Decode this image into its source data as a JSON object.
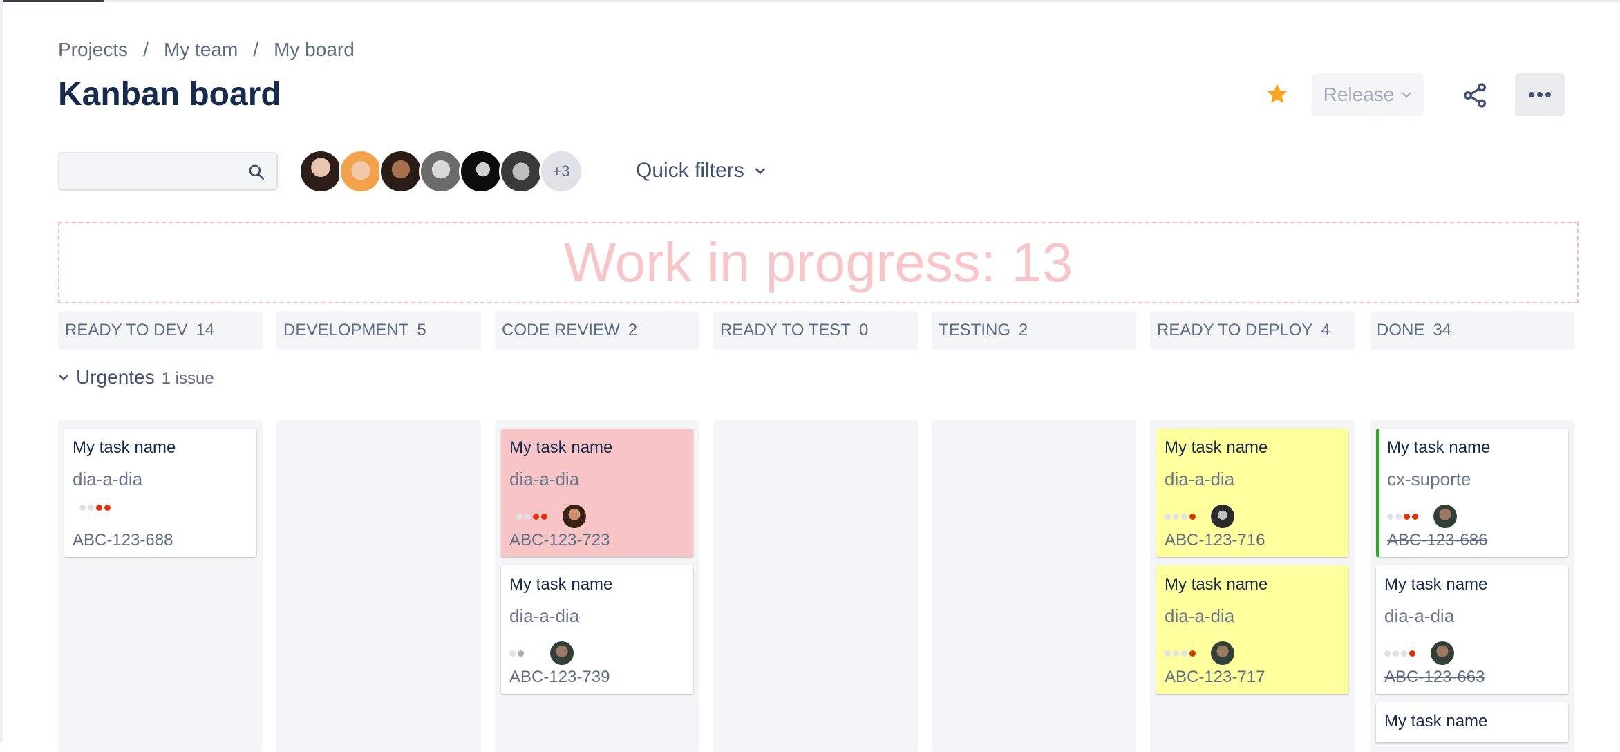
{
  "breadcrumbs": [
    "Projects",
    "My team",
    "My board"
  ],
  "title": "Kanban board",
  "header_actions": {
    "release_label": "Release"
  },
  "search": {
    "placeholder": ""
  },
  "avatars": {
    "more_label": "+3"
  },
  "quick_filters_label": "Quick filters",
  "wip_banner": "Work in progress: 13",
  "columns": [
    {
      "name": "READY TO DEV",
      "count": "14"
    },
    {
      "name": "DEVELOPMENT",
      "count": "5"
    },
    {
      "name": "CODE REVIEW",
      "count": "2"
    },
    {
      "name": "READY TO TEST",
      "count": "0"
    },
    {
      "name": "TESTING",
      "count": "2"
    },
    {
      "name": "READY TO DEPLOY",
      "count": "4"
    },
    {
      "name": "DONE",
      "count": "34"
    }
  ],
  "swimlane": {
    "name": "Urgentes",
    "count": "1 issue"
  },
  "cards": [
    {
      "title": "My task name",
      "epic": "dia-a-dia",
      "key": "ABC-123-688",
      "color": "#ffffff"
    },
    {
      "title": "My task name",
      "epic": "dia-a-dia",
      "key": "ABC-123-723",
      "color": "#f7c5c6"
    },
    {
      "title": "My task name",
      "epic": "dia-a-dia",
      "key": "ABC-123-739",
      "color": "#ffffff"
    },
    {
      "title": "My task name",
      "epic": "dia-a-dia",
      "key": "ABC-123-716",
      "color": "#ffff9d"
    },
    {
      "title": "My task name",
      "epic": "dia-a-dia",
      "key": "ABC-123-717",
      "color": "#ffff9d"
    },
    {
      "title": "My task name",
      "epic": "cx-suporte",
      "key": "ABC-123-686",
      "color": "#ffffff"
    },
    {
      "title": "My task name",
      "epic": "dia-a-dia",
      "key": "ABC-123-663",
      "color": "#ffffff"
    },
    {
      "title": "My task name"
    }
  ],
  "colors": {
    "star": "#f5a623",
    "done_edge": "#36a32d",
    "wip_text": "#f6c6c9",
    "priority_dot": "#de350b"
  },
  "icons": [
    "star-icon",
    "chevron-down-icon",
    "share-icon",
    "more-icon",
    "search-icon"
  ]
}
